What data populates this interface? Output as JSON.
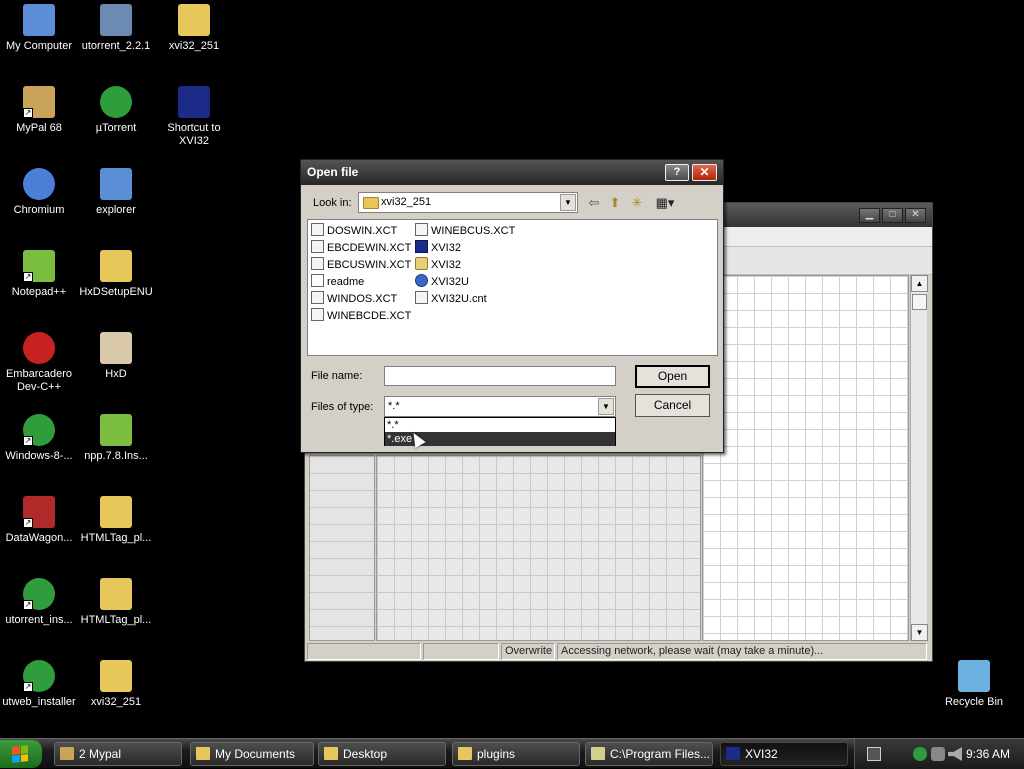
{
  "desktop": {
    "icons": [
      {
        "label": "My Computer",
        "icon": "computer-icon",
        "color": "#5b8ed6"
      },
      {
        "label": "utorrent_2.2.1",
        "icon": "installer-icon",
        "color": "#6b8bb3"
      },
      {
        "label": "xvi32_251",
        "icon": "folder-icon",
        "color": "#e6c75a"
      },
      {
        "label": "MyPal 68",
        "icon": "mypal-icon",
        "color": "#c9a35a"
      },
      {
        "label": "µTorrent",
        "icon": "utorrent-icon",
        "color": "#2f9d3c"
      },
      {
        "label": "Shortcut to XVI32",
        "icon": "xvi32-icon",
        "color": "#1c2a88"
      },
      {
        "label": "Chromium",
        "icon": "chromium-icon",
        "color": "#4d7fd8"
      },
      {
        "label": "explorer",
        "icon": "explorer-icon",
        "color": "#5b8ed6"
      },
      {
        "label": "Notepad++",
        "icon": "notepad-icon",
        "color": "#7bbd3e"
      },
      {
        "label": "HxDSetupENU",
        "icon": "zip-folder-icon",
        "color": "#e6c75a"
      },
      {
        "label": "Embarcadero Dev-C++",
        "icon": "devcpp-icon",
        "color": "#c82323"
      },
      {
        "label": "HxD",
        "icon": "hxd-icon",
        "color": "#d9c9a8"
      },
      {
        "label": "Windows-8-...",
        "icon": "utorrent-icon",
        "color": "#2f9d3c"
      },
      {
        "label": "npp.7.8.Ins...",
        "icon": "npp-installer-icon",
        "color": "#7bbd3e"
      },
      {
        "label": "DataWagon...",
        "icon": "datawagon-icon",
        "color": "#b02a2a"
      },
      {
        "label": "HTMLTag_pl...",
        "icon": "zip-folder-icon",
        "color": "#e6c75a"
      },
      {
        "label": "utorrent_ins...",
        "icon": "utorrent-icon",
        "color": "#2f9d3c"
      },
      {
        "label": "HTMLTag_pl...",
        "icon": "folder-icon",
        "color": "#e6c75a"
      },
      {
        "label": "utweb_installer",
        "icon": "utorrent-icon",
        "color": "#2f9d3c"
      },
      {
        "label": "xvi32_251",
        "icon": "zip-folder-icon",
        "color": "#e6c75a"
      },
      {
        "label": "Recycle Bin",
        "icon": "recycle-bin-icon",
        "color": "#6bb2e0"
      }
    ]
  },
  "xvi_window": {
    "status": [
      "",
      "",
      "Overwrite",
      "Accessing network, please wait (may take a minute)..."
    ],
    "min_icon": "minimize-icon",
    "max_icon": "maximize-icon",
    "close_icon": "close-icon"
  },
  "dialog": {
    "title": "Open file",
    "help": "?",
    "close": "✕",
    "look_in_label": "Look in:",
    "look_in_value": "xvi32_251",
    "files": [
      {
        "name": "DOSWIN.XCT",
        "icon": "xct-file-icon"
      },
      {
        "name": "EBCDEWIN.XCT",
        "icon": "xct-file-icon"
      },
      {
        "name": "EBCUSWIN.XCT",
        "icon": "xct-file-icon"
      },
      {
        "name": "readme",
        "icon": "text-file-icon"
      },
      {
        "name": "WINDOS.XCT",
        "icon": "xct-file-icon"
      },
      {
        "name": "WINEBCDE.XCT",
        "icon": "xct-file-icon"
      },
      {
        "name": "WINEBCUS.XCT",
        "icon": "xct-file-icon"
      },
      {
        "name": "XVI32",
        "icon": "xvi32-exe-icon"
      },
      {
        "name": "XVI32",
        "icon": "config-file-icon"
      },
      {
        "name": "XVI32U",
        "icon": "help-file-icon"
      },
      {
        "name": "XVI32U.cnt",
        "icon": "xct-file-icon"
      }
    ],
    "file_name_label": "File name:",
    "file_name_value": "",
    "file_type_label": "Files of type:",
    "file_type_value": "*.*",
    "file_type_options": [
      "*.*",
      "*.exe"
    ],
    "file_type_highlighted": "*.exe",
    "open_label": "Open",
    "cancel_label": "Cancel"
  },
  "taskbar": {
    "buttons": [
      {
        "label": "2 Mypal",
        "icon": "mypal-icon",
        "color": "#c9a35a",
        "active": false
      },
      {
        "label": "My Documents",
        "icon": "folder-icon",
        "color": "#e6c75a",
        "active": false
      },
      {
        "label": "Desktop",
        "icon": "folder-icon",
        "color": "#e6c75a",
        "active": false
      },
      {
        "label": "plugins",
        "icon": "folder-icon",
        "color": "#e6c75a",
        "active": false
      },
      {
        "label": "C:\\Program Files...",
        "icon": "notepad-icon",
        "color": "#d4d088",
        "active": false
      },
      {
        "label": "XVI32",
        "icon": "xvi32-icon",
        "color": "#1c2a88",
        "active": true
      }
    ],
    "clock": "9:36 AM",
    "tray_icons": [
      "keyboard-icon",
      "utorrent-icon",
      "network-icon",
      "volume-icon"
    ]
  }
}
